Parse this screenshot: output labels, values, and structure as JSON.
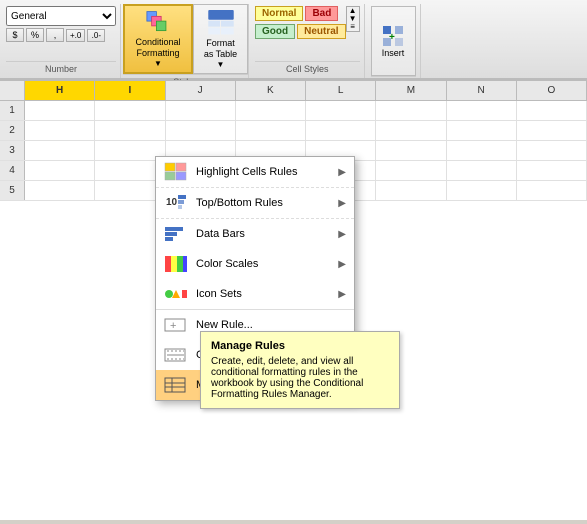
{
  "ribbon": {
    "number_format": "General",
    "currency": "$",
    "percent": "%",
    "comma": ",",
    "decimal_increase": ".00\n→.0",
    "decimal_decrease": ".0\n→.00",
    "styles": {
      "normal": "Normal",
      "bad": "Bad",
      "good": "Good",
      "neutral": "Neutral"
    },
    "cond_format_label": "Conditional\nFormatting",
    "format_table_label": "Format\nas Table",
    "insert_label": "Insert"
  },
  "columns": [
    "H",
    "I",
    "J",
    "K",
    "L",
    "M",
    "N",
    "O"
  ],
  "menu": {
    "items": [
      {
        "id": "highlight",
        "label": "Highlight Cells Rules",
        "has_arrow": true,
        "icon": "highlight-icon"
      },
      {
        "id": "topbottom",
        "label": "Top/Bottom Rules",
        "has_arrow": true,
        "icon": "topbottom-icon"
      },
      {
        "id": "databars",
        "label": "Data Bars",
        "has_arrow": true,
        "icon": "databars-icon"
      },
      {
        "id": "colorscales",
        "label": "Color Scales",
        "has_arrow": true,
        "icon": "colorscales-icon"
      },
      {
        "id": "iconsets",
        "label": "Icon Sets",
        "has_arrow": true,
        "icon": "iconsets-icon"
      },
      {
        "id": "newrule",
        "label": "New Rule...",
        "has_arrow": false,
        "icon": "newrule-icon",
        "separator": true
      },
      {
        "id": "clearrules",
        "label": "Clear Rules",
        "has_arrow": false,
        "icon": "clearrules-icon"
      },
      {
        "id": "managerules",
        "label": "Manage Rules...",
        "has_arrow": false,
        "icon": "managerules-icon",
        "highlighted": true
      }
    ]
  },
  "tooltip": {
    "title": "Manage Rules",
    "text": "Create, edit, delete, and view all conditional formatting rules in the workbook by using the Conditional Formatting Rules Manager."
  }
}
